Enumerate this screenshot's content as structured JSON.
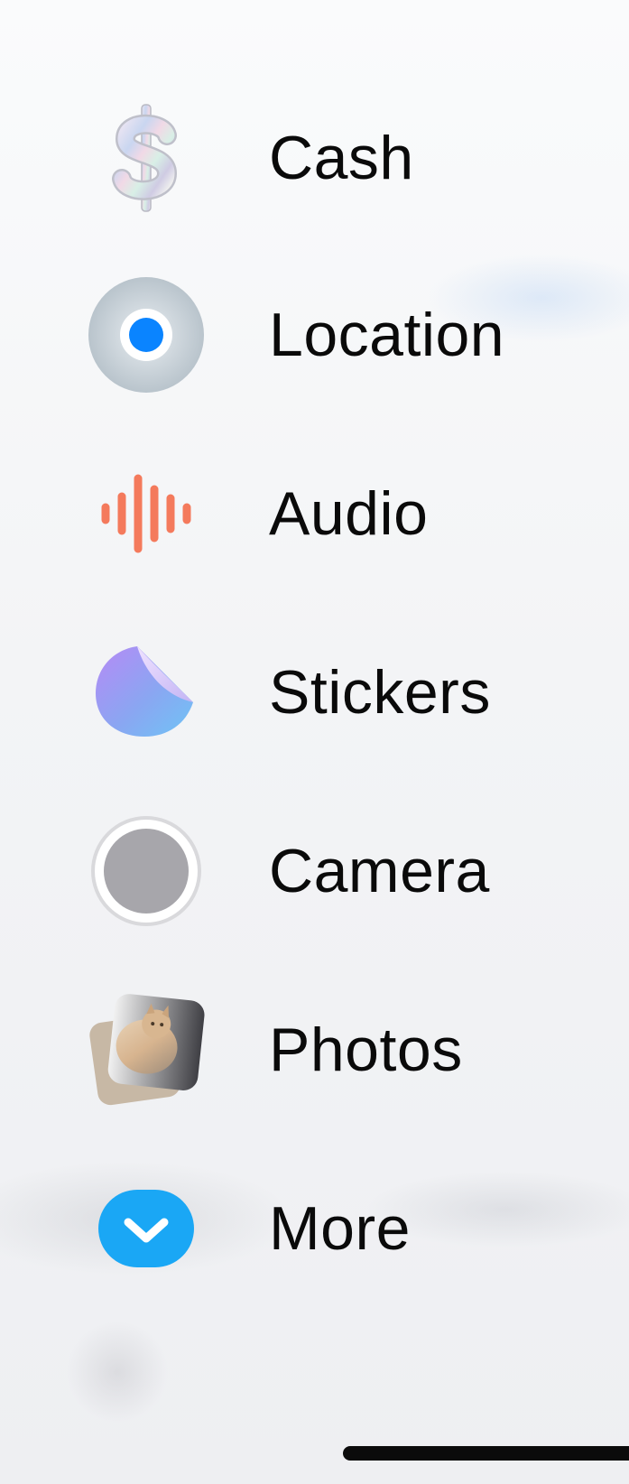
{
  "menu": {
    "items": [
      {
        "label": "Cash",
        "icon": "dollar-sign-icon"
      },
      {
        "label": "Location",
        "icon": "location-pin-icon"
      },
      {
        "label": "Audio",
        "icon": "audio-waveform-icon"
      },
      {
        "label": "Stickers",
        "icon": "sticker-icon"
      },
      {
        "label": "Camera",
        "icon": "camera-shutter-icon"
      },
      {
        "label": "Photos",
        "icon": "photos-stack-icon"
      },
      {
        "label": "More",
        "icon": "chevron-down-icon"
      }
    ]
  },
  "colors": {
    "label_text": "#0a0a0a",
    "location_dot": "#0a84ff",
    "audio_wave": "#f47a5c",
    "more_button": "#1aa7f5",
    "camera_shutter": "#a7a6ab"
  }
}
